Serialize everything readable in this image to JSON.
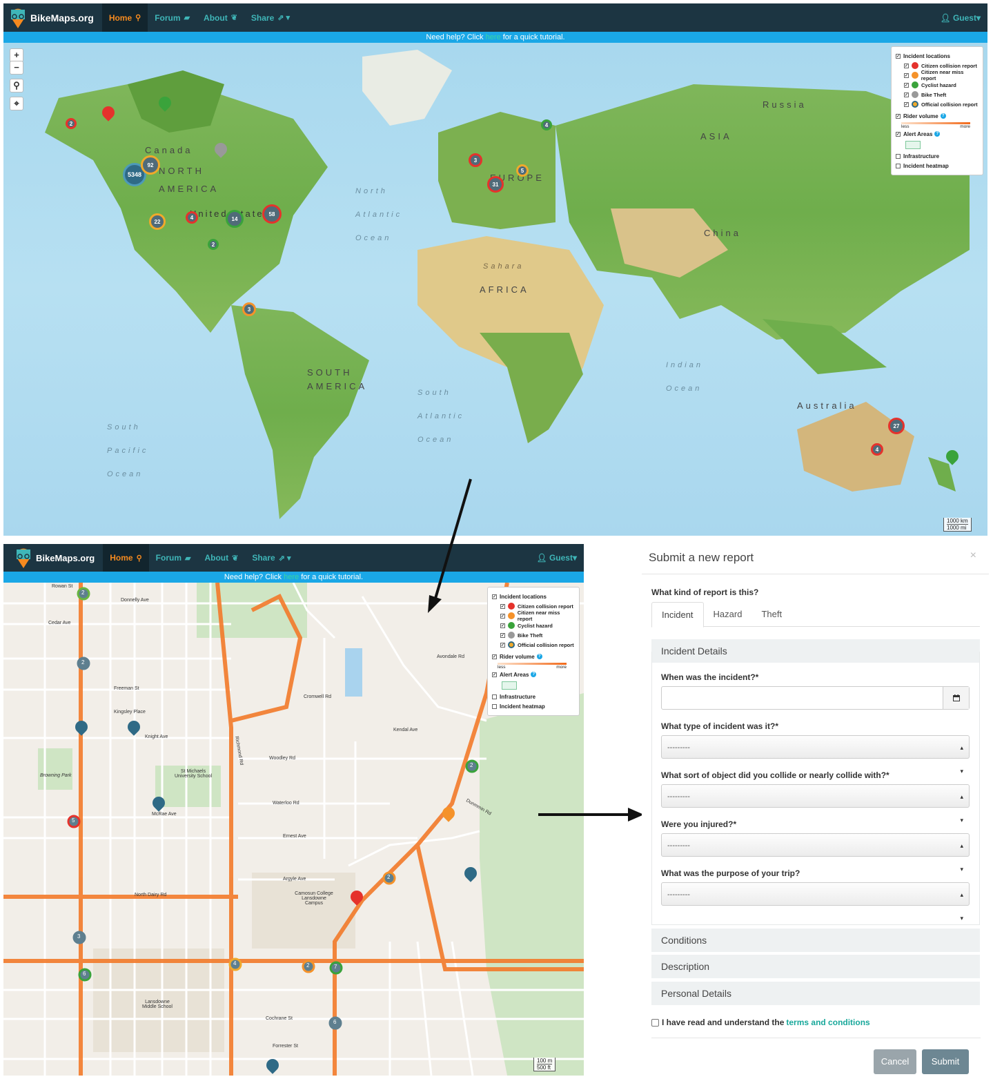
{
  "app": {
    "brand": "BikeMaps.org",
    "nav": [
      {
        "label": "Home",
        "icon": "map-pin-icon"
      },
      {
        "label": "Forum",
        "icon": "comment-icon"
      },
      {
        "label": "About",
        "icon": "leaf-icon"
      },
      {
        "label": "Share",
        "icon": "share-icon"
      }
    ],
    "user": "Guest",
    "help_prefix": "Need help? Click ",
    "help_link": "here",
    "help_suffix": " for a quick tutorial."
  },
  "legend": {
    "incident_locations": "Incident locations",
    "items": [
      {
        "label": "Citizen collision report",
        "color": "#e5322c"
      },
      {
        "label": "Citizen near miss report",
        "color": "#f5922a"
      },
      {
        "label": "Cyclist hazard",
        "color": "#3aa33b"
      },
      {
        "label": "Bike Theft",
        "color": "#999999"
      },
      {
        "label": "Official collision report",
        "color": "#f0a92b"
      }
    ],
    "rider_volume": "Rider volume",
    "less": "less",
    "more": "more",
    "alert_areas": "Alert Areas",
    "infrastructure": "Infrastructure",
    "heatmap": "Incident heatmap"
  },
  "world_map": {
    "labels": {
      "canada": "Canada",
      "north_america": "NORTH AMERICA",
      "north_atlantic": "North Atlantic Ocean",
      "south_america": "SOUTH AMERICA",
      "south_pacific": "South Pacific Ocean",
      "south_atlantic": "South Atlantic Ocean",
      "africa": "AFRICA",
      "europe": "EUROPE",
      "asia": "ASIA",
      "russia": "Russia",
      "china": "China",
      "indian_ocean": "Indian Ocean",
      "australia": "Australia",
      "sahara": "Sahara",
      "united_states": "United States"
    },
    "clusters": [
      "5348",
      "92",
      "22",
      "4",
      "14",
      "58",
      "2",
      "3",
      "31",
      "5",
      "3",
      "4",
      "27",
      "4",
      "2"
    ],
    "scale_km": "1000 km",
    "scale_mi": "1000 mi"
  },
  "street_map": {
    "streets": [
      "Rowan St",
      "Donnelly Ave",
      "Cedar Ave",
      "Freeman St",
      "Kingsley Place",
      "Knight Ave",
      "Cromwell Rd",
      "Kendal Ave",
      "Woodley Rd",
      "Waterloo Rd",
      "McRae Ave",
      "Ernest Ave",
      "Argyle Ave",
      "North Dairy Rd",
      "Cochrane St",
      "Forrester St",
      "Richmond Rd",
      "Dunmmin Rd",
      "Avondale Rd"
    ],
    "places": [
      "St Michaels University School",
      "Camosun College Lansdowne Campus",
      "Browning Park",
      "Lansdowne Middle School"
    ],
    "markers": [
      "2",
      "2",
      "5",
      "3",
      "6",
      "4",
      "2",
      "7",
      "6",
      "2",
      "2"
    ],
    "scale_m": "100 m",
    "scale_ft": "500 ft"
  },
  "form": {
    "title": "Submit a new report",
    "question": "What kind of report is this?",
    "tabs": [
      "Incident",
      "Hazard",
      "Theft"
    ],
    "section_incident": "Incident Details",
    "fields": [
      {
        "label": "When was the incident?*",
        "value": ""
      },
      {
        "label": "What type of incident was it?*",
        "value": "---------"
      },
      {
        "label": "What sort of object did you collide or nearly collide with?*",
        "value": "---------"
      },
      {
        "label": "Were you injured?*",
        "value": "---------"
      },
      {
        "label": "What was the purpose of your trip?",
        "value": "---------"
      }
    ],
    "sections": [
      "Conditions",
      "Description",
      "Personal Details"
    ],
    "terms_prefix": "I have read and understand the",
    "terms_link": "terms and conditions",
    "cancel": "Cancel",
    "submit": "Submit",
    "close": "×"
  }
}
